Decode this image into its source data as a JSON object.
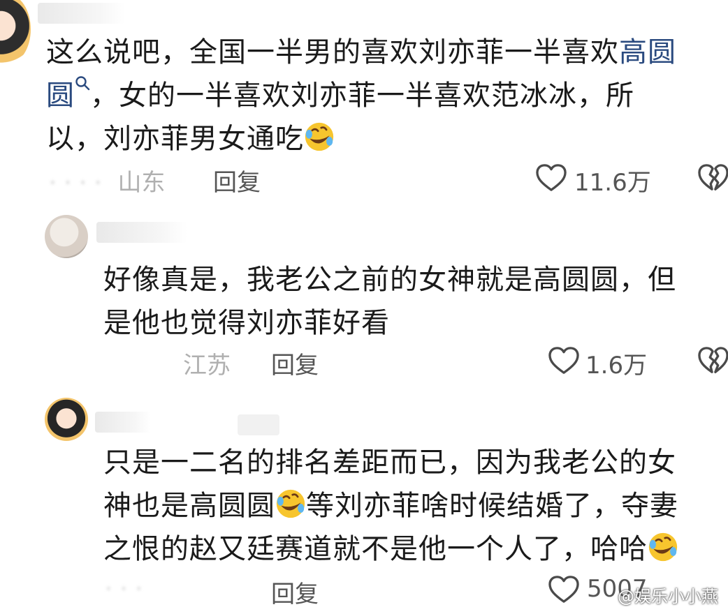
{
  "comments": [
    {
      "text_parts": [
        "这么说吧，全国一半男的喜欢刘亦菲一半喜欢",
        "高圆",
        "圆",
        "，女的一半喜欢刘亦菲一半喜欢范冰冰，所以，刘亦菲男女通吃"
      ],
      "keyword_1": "高圆",
      "keyword_2": "圆",
      "line1": "这么说吧，全国一半男的喜欢刘亦菲一半喜欢",
      "line2_rest": "，女的一半喜欢刘亦菲一半喜欢范冰冰，所",
      "line3": "以，刘亦菲男女通吃",
      "location": "山东",
      "reply_label": "回复",
      "likes": "11.6万"
    },
    {
      "line1": "好像真是，我老公之前的女神就是高圆圆，但",
      "line2": "是他也觉得刘亦菲好看",
      "location": "江苏",
      "reply_label": "回复",
      "likes": "1.6万"
    },
    {
      "line1": "只是一二名的排名差距而已，因为我老公的女",
      "line2a": "神也是高圆圆",
      "line2b": "等刘亦菲啥时候结婚了，夺妻",
      "line3": "之恨的赵又廷赛道就不是他一个人了，哈哈",
      "reply_label": "回复",
      "likes": "5007"
    }
  ],
  "watermark": "@娱乐小小燕",
  "icons": {
    "like": "heart-outline-icon",
    "dislike": "broken-heart-icon",
    "search": "search-icon",
    "emoji": "rofl-emoji-icon"
  },
  "colors": {
    "keyword": "#2a4a7f",
    "text": "#1a1a1a",
    "muted": "#b0b0b0"
  }
}
